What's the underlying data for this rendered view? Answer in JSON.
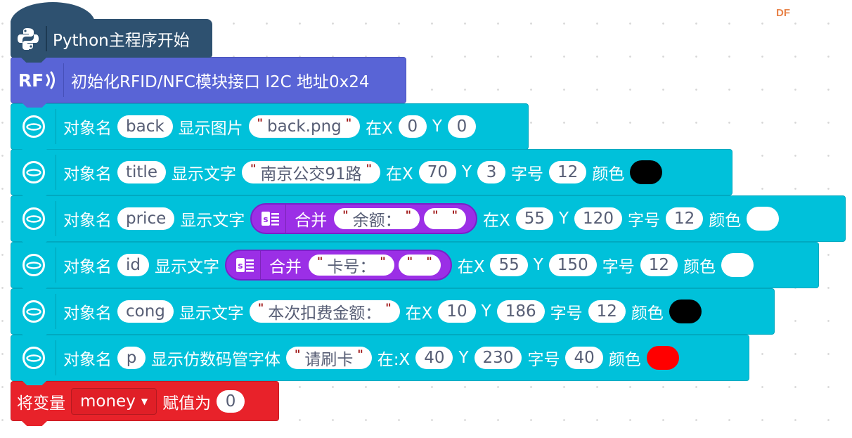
{
  "watermark": "DF",
  "hat_block": {
    "icon": "python-icon",
    "label": "Python主程序开始",
    "color": "#2e5170"
  },
  "rfid_block": {
    "icon": "rf-icon",
    "icon_text": "RF",
    "label": "初始化RFID/NFC模块接口 I2C 地址0x24",
    "color": "#5964d6"
  },
  "object_block_color": "#00c1da",
  "object_blocks": [
    {
      "prefix": "对象名",
      "name": "back",
      "action": "显示图片",
      "text": "back.png",
      "x_label": "在X",
      "x": "0",
      "y_label": "Y",
      "y": "0"
    },
    {
      "prefix": "对象名",
      "name": "title",
      "action": "显示文字",
      "text": "南京公交91路",
      "x_label": "在X",
      "x": "70",
      "y_label": "Y",
      "y": "3",
      "size_label": "字号",
      "size": "12",
      "color_label": "颜色",
      "color": "#000000"
    },
    {
      "prefix": "对象名",
      "name": "price",
      "action": "显示文字",
      "join": {
        "icon": "string-join-icon",
        "label": "合并",
        "a": "余额：",
        "b": " "
      },
      "x_label": "在X",
      "x": "55",
      "y_label": "Y",
      "y": "120",
      "size_label": "字号",
      "size": "12",
      "color_label": "颜色",
      "color": "#ffffff"
    },
    {
      "prefix": "对象名",
      "name": "id",
      "action": "显示文字",
      "join": {
        "icon": "string-join-icon",
        "label": "合并",
        "a": "卡号：",
        "b": " "
      },
      "x_label": "在X",
      "x": "55",
      "y_label": "Y",
      "y": "150",
      "size_label": "字号",
      "size": "12",
      "color_label": "颜色",
      "color": "#ffffff"
    },
    {
      "prefix": "对象名",
      "name": "cong",
      "action": "显示文字",
      "text": "本次扣费金额：",
      "x_label": "在X",
      "x": "10",
      "y_label": "Y",
      "y": "186",
      "size_label": "字号",
      "size": "12",
      "color_label": "颜色",
      "color": "#000000"
    },
    {
      "prefix": "对象名",
      "name": "p",
      "action": "显示仿数码管字体",
      "text": "请刷卡",
      "x_label": "在:X",
      "x": "40",
      "y_label": "Y",
      "y": "230",
      "size_label": "字号",
      "size": "40",
      "color_label": "颜色",
      "color": "#ff0000"
    }
  ],
  "set_variable_block": {
    "prefix": "将变量",
    "variable": "money",
    "suffix": "赋值为",
    "value": "0",
    "color": "#e8222a"
  }
}
